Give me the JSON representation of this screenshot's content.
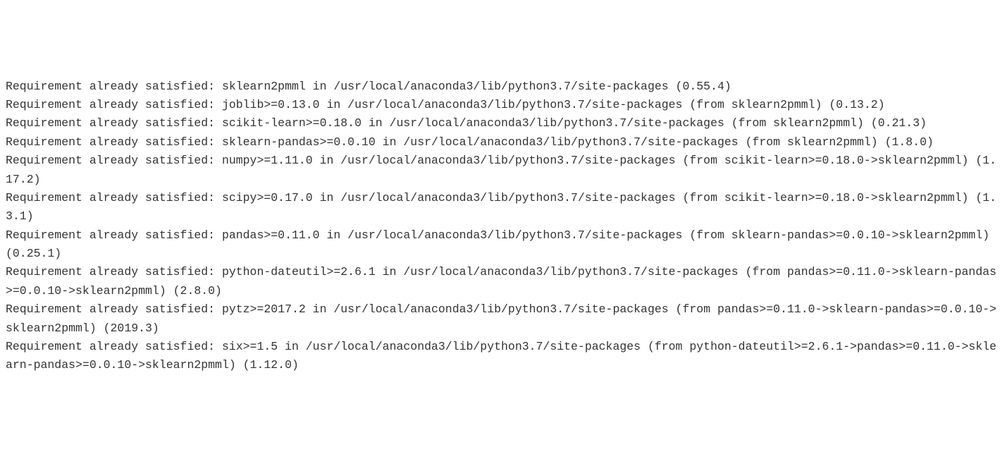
{
  "pip_output": {
    "lines": [
      "Requirement already satisfied: sklearn2pmml in /usr/local/anaconda3/lib/python3.7/site-packages (0.55.4)",
      "Requirement already satisfied: joblib>=0.13.0 in /usr/local/anaconda3/lib/python3.7/site-packages (from sklearn2pmml) (0.13.2)",
      "Requirement already satisfied: scikit-learn>=0.18.0 in /usr/local/anaconda3/lib/python3.7/site-packages (from sklearn2pmml) (0.21.3)",
      "Requirement already satisfied: sklearn-pandas>=0.0.10 in /usr/local/anaconda3/lib/python3.7/site-packages (from sklearn2pmml) (1.8.0)",
      "Requirement already satisfied: numpy>=1.11.0 in /usr/local/anaconda3/lib/python3.7/site-packages (from scikit-learn>=0.18.0->sklearn2pmml) (1.17.2)",
      "Requirement already satisfied: scipy>=0.17.0 in /usr/local/anaconda3/lib/python3.7/site-packages (from scikit-learn>=0.18.0->sklearn2pmml) (1.3.1)",
      "Requirement already satisfied: pandas>=0.11.0 in /usr/local/anaconda3/lib/python3.7/site-packages (from sklearn-pandas>=0.0.10->sklearn2pmml) (0.25.1)",
      "Requirement already satisfied: python-dateutil>=2.6.1 in /usr/local/anaconda3/lib/python3.7/site-packages (from pandas>=0.11.0->sklearn-pandas>=0.0.10->sklearn2pmml) (2.8.0)",
      "Requirement already satisfied: pytz>=2017.2 in /usr/local/anaconda3/lib/python3.7/site-packages (from pandas>=0.11.0->sklearn-pandas>=0.0.10->sklearn2pmml) (2019.3)",
      "Requirement already satisfied: six>=1.5 in /usr/local/anaconda3/lib/python3.7/site-packages (from python-dateutil>=2.6.1->pandas>=0.11.0->sklearn-pandas>=0.0.10->sklearn2pmml) (1.12.0)"
    ]
  }
}
